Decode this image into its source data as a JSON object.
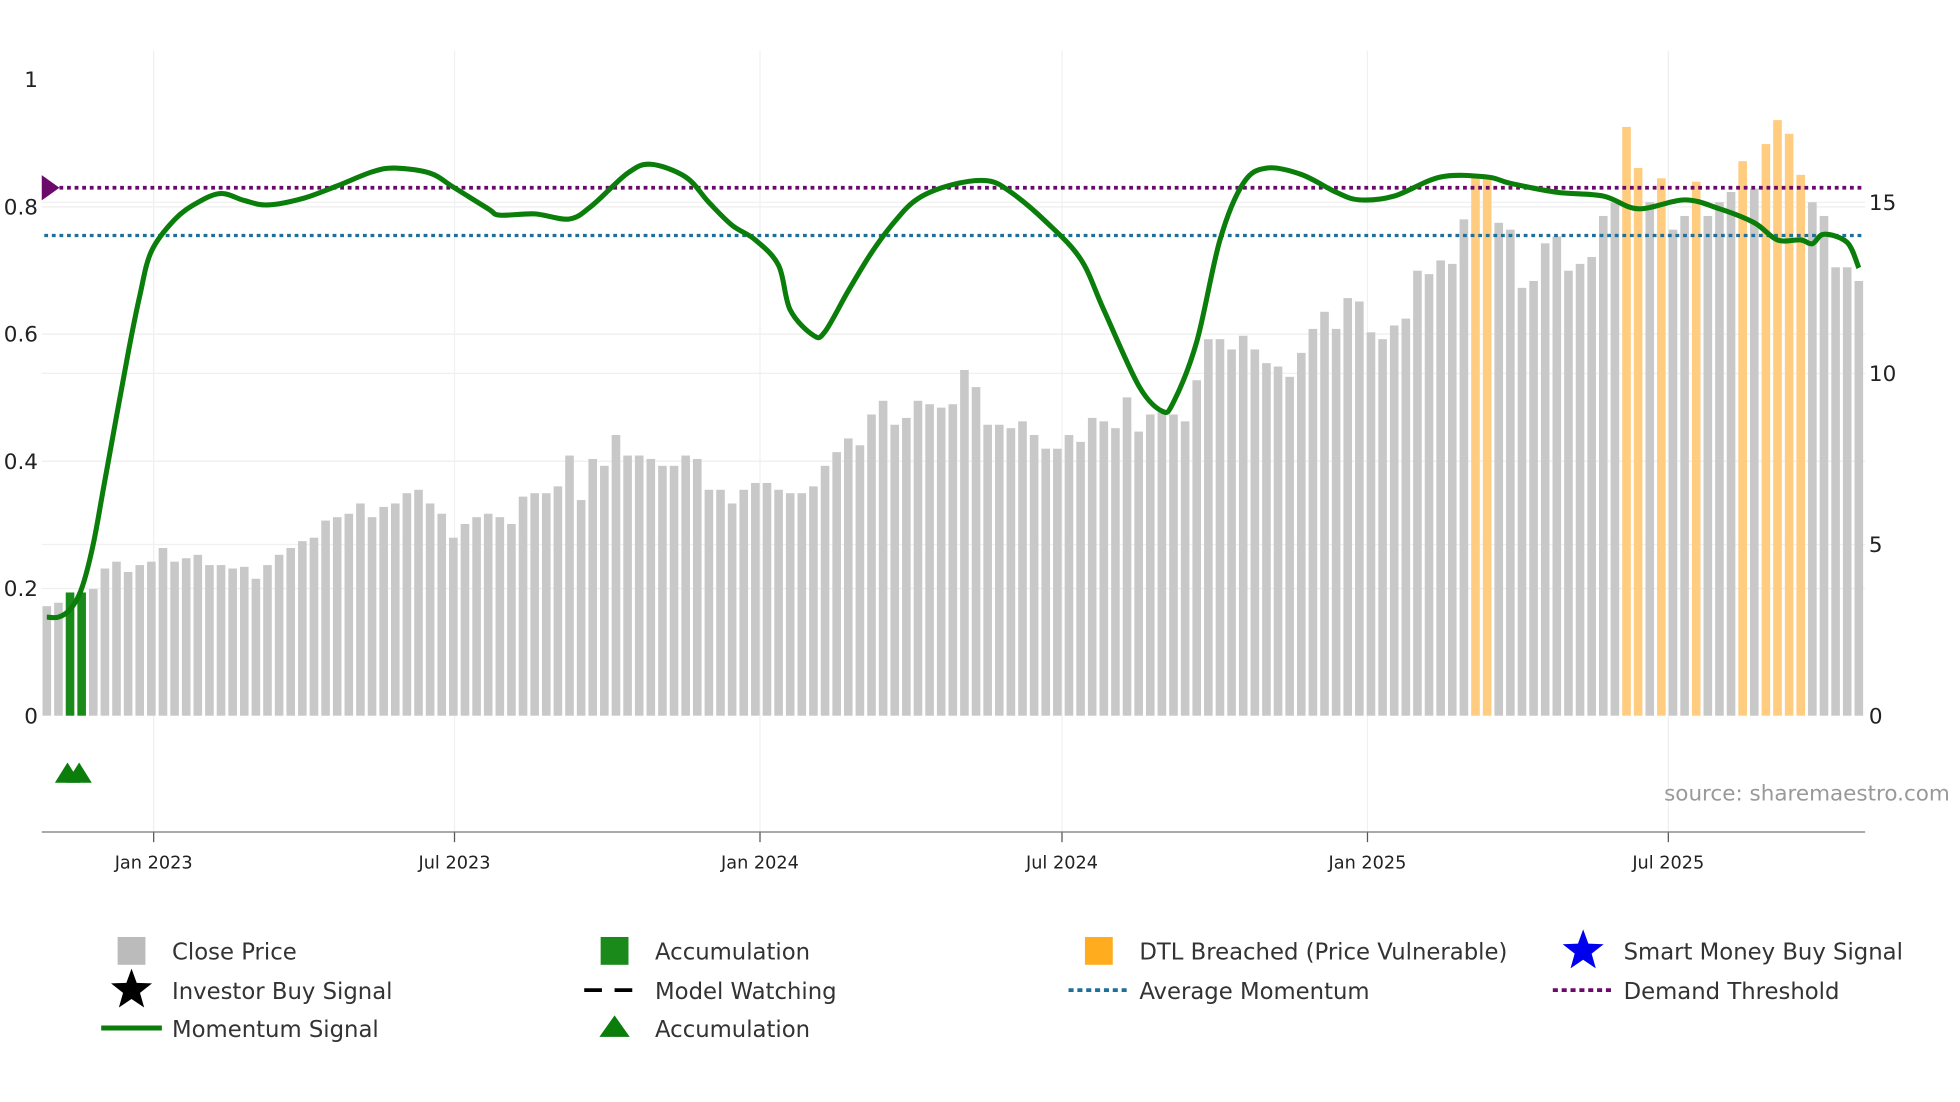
{
  "chart_data": {
    "type": "bar",
    "title": "",
    "source": "source: sharemaestro.com",
    "left_axis": {
      "ylim": [
        0,
        1
      ],
      "ticks": [
        "0",
        "0.2",
        "0.4",
        "0.6",
        "0.8",
        "1"
      ],
      "tick_values": [
        0,
        0.2,
        0.4,
        0.6,
        0.8,
        1
      ]
    },
    "right_axis": {
      "ylim": [
        0,
        18.6
      ],
      "ticks": [
        "0",
        "5",
        "10",
        "15"
      ],
      "tick_values": [
        0,
        5,
        10,
        15
      ]
    },
    "x_ticks": [
      {
        "label": "Jan 2023",
        "index": 9.2
      },
      {
        "label": "Jul 2023",
        "index": 35.1
      },
      {
        "label": "Jan 2024",
        "index": 61.4
      },
      {
        "label": "Jul 2024",
        "index": 87.4
      },
      {
        "label": "Jan 2025",
        "index": 113.7
      },
      {
        "label": "Jul 2025",
        "index": 139.6
      }
    ],
    "close_price": [
      3.2,
      3.3,
      3.6,
      3.6,
      3.7,
      4.3,
      4.5,
      4.2,
      4.4,
      4.5,
      4.9,
      4.5,
      4.6,
      4.7,
      4.4,
      4.4,
      4.3,
      4.35,
      4.0,
      4.4,
      4.7,
      4.9,
      5.1,
      5.2,
      5.7,
      5.8,
      5.9,
      6.2,
      5.8,
      6.1,
      6.2,
      6.5,
      6.6,
      6.2,
      5.9,
      5.2,
      5.6,
      5.8,
      5.9,
      5.8,
      5.6,
      6.4,
      6.5,
      6.5,
      6.7,
      7.6,
      6.3,
      7.5,
      7.3,
      8.2,
      7.6,
      7.6,
      7.5,
      7.3,
      7.3,
      7.6,
      7.5,
      6.6,
      6.6,
      6.2,
      6.6,
      6.8,
      6.8,
      6.6,
      6.5,
      6.5,
      6.7,
      7.3,
      7.7,
      8.1,
      7.9,
      8.8,
      9.2,
      8.5,
      8.7,
      9.2,
      9.1,
      9.0,
      9.1,
      10.1,
      9.6,
      8.5,
      8.5,
      8.4,
      8.6,
      8.2,
      7.8,
      7.8,
      8.2,
      8.0,
      8.7,
      8.6,
      8.4,
      9.3,
      8.3,
      8.8,
      8.9,
      8.8,
      8.6,
      9.8,
      11.0,
      11.0,
      10.7,
      11.1,
      10.7,
      10.3,
      10.2,
      9.9,
      10.6,
      11.3,
      11.8,
      11.3,
      12.2,
      12.1,
      11.2,
      11.0,
      11.4,
      11.6,
      13.0,
      12.9,
      13.3,
      13.2,
      14.5,
      15.8,
      15.7,
      14.4,
      14.2,
      12.5,
      12.7,
      13.8,
      14.0,
      13.0,
      13.2,
      13.4,
      14.6,
      15.0,
      17.2,
      16.0,
      15.0,
      15.7,
      14.2,
      14.6,
      15.6,
      14.6,
      15.0,
      15.3,
      16.2,
      15.4,
      16.7,
      17.4,
      17.0,
      15.8,
      15.0,
      14.6,
      13.1,
      13.1,
      12.7
    ],
    "accumulation_indices": [
      2,
      3
    ],
    "dtl_breached_indices": [
      123,
      124,
      136,
      137,
      139,
      142,
      146,
      148,
      149,
      150,
      151
    ],
    "accumulation_triangles": [
      2,
      3
    ],
    "momentum": [
      [
        0,
        0.155
      ],
      [
        1,
        0.155
      ],
      [
        2,
        0.167
      ],
      [
        3,
        0.2
      ],
      [
        4,
        0.27
      ],
      [
        5,
        0.37
      ],
      [
        7,
        0.57
      ],
      [
        8,
        0.66
      ],
      [
        9,
        0.73
      ],
      [
        11,
        0.78
      ],
      [
        13,
        0.807
      ],
      [
        15,
        0.821
      ],
      [
        17,
        0.81
      ],
      [
        19,
        0.803
      ],
      [
        22,
        0.813
      ],
      [
        25,
        0.833
      ],
      [
        28,
        0.855
      ],
      [
        30,
        0.861
      ],
      [
        33,
        0.853
      ],
      [
        35,
        0.831
      ],
      [
        38,
        0.797
      ],
      [
        39,
        0.787
      ],
      [
        42,
        0.789
      ],
      [
        45,
        0.781
      ],
      [
        47,
        0.803
      ],
      [
        50,
        0.853
      ],
      [
        52,
        0.867
      ],
      [
        55,
        0.847
      ],
      [
        57,
        0.807
      ],
      [
        59,
        0.771
      ],
      [
        61,
        0.748
      ],
      [
        63,
        0.708
      ],
      [
        64,
        0.638
      ],
      [
        66,
        0.598
      ],
      [
        67,
        0.604
      ],
      [
        69,
        0.668
      ],
      [
        71,
        0.728
      ],
      [
        73,
        0.777
      ],
      [
        75,
        0.813
      ],
      [
        78,
        0.835
      ],
      [
        81,
        0.841
      ],
      [
        83,
        0.823
      ],
      [
        86,
        0.777
      ],
      [
        89,
        0.718
      ],
      [
        91,
        0.638
      ],
      [
        94,
        0.519
      ],
      [
        96,
        0.479
      ],
      [
        97,
        0.493
      ],
      [
        99,
        0.588
      ],
      [
        101,
        0.748
      ],
      [
        103,
        0.837
      ],
      [
        105,
        0.861
      ],
      [
        108,
        0.851
      ],
      [
        111,
        0.823
      ],
      [
        113,
        0.811
      ],
      [
        116,
        0.817
      ],
      [
        120,
        0.847
      ],
      [
        124,
        0.847
      ],
      [
        126,
        0.837
      ],
      [
        130,
        0.823
      ],
      [
        134,
        0.817
      ],
      [
        137,
        0.797
      ],
      [
        141,
        0.811
      ],
      [
        144,
        0.797
      ],
      [
        147,
        0.775
      ],
      [
        149,
        0.748
      ],
      [
        151,
        0.748
      ],
      [
        152,
        0.742
      ],
      [
        153,
        0.757
      ],
      [
        155,
        0.744
      ],
      [
        156,
        0.704
      ]
    ],
    "demand_threshold": 0.83,
    "average_momentum": 0.755,
    "colors": {
      "price": "#c8c8c8",
      "accumulation": "#1a8a1a",
      "dtl": "#ffcc80",
      "momentum": "#0a7d0a",
      "avg": "#1f6f99",
      "threshold": "#6b0a6b",
      "triangle": "#0a7d0a"
    },
    "legend": [
      {
        "label": "Close Price",
        "symbol": "bar-gray"
      },
      {
        "label": "Accumulation",
        "symbol": "bar-green"
      },
      {
        "label": "DTL Breached (Price Vulnerable)",
        "symbol": "bar-orange"
      },
      {
        "label": "Smart Money Buy Signal",
        "symbol": "star-blue"
      },
      {
        "label": "Investor Buy Signal",
        "symbol": "star-black"
      },
      {
        "label": "Model Watching",
        "symbol": "dash-black"
      },
      {
        "label": "Average Momentum",
        "symbol": "dot-blue"
      },
      {
        "label": "Demand Threshold",
        "symbol": "dot-purple"
      },
      {
        "label": "Momentum Signal",
        "symbol": "line-green"
      },
      {
        "label": "Accumulation",
        "symbol": "triangle-green"
      }
    ]
  }
}
